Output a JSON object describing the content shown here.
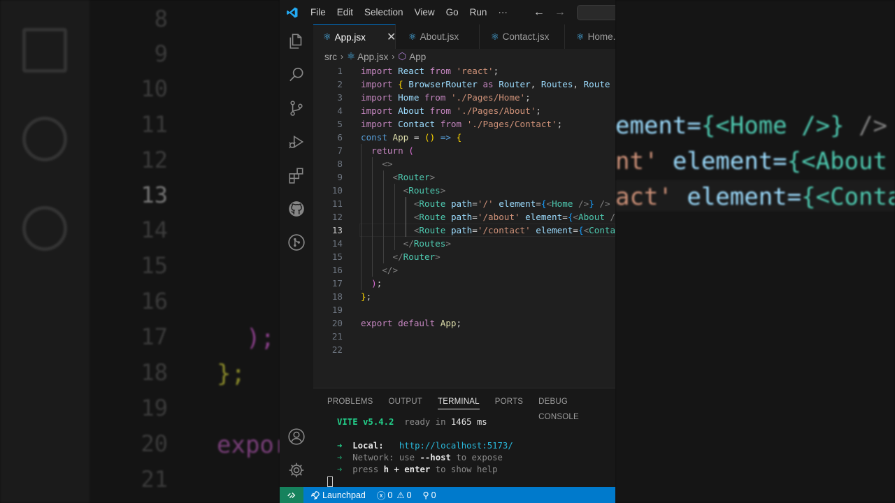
{
  "menu": [
    "File",
    "Edit",
    "Selection",
    "View",
    "Go",
    "Run",
    "···"
  ],
  "nav": {
    "back": "←",
    "forward": "→"
  },
  "tabs": [
    {
      "label": "App.jsx",
      "active": true,
      "close": "✕"
    },
    {
      "label": "About.jsx",
      "active": false
    },
    {
      "label": "Contact.jsx",
      "active": false
    },
    {
      "label": "Home.",
      "active": false
    }
  ],
  "breadcrumb": {
    "folder": "src",
    "file": "App.jsx",
    "symbol": "App"
  },
  "editor": {
    "current_line": 13,
    "line_numbers": [
      "1",
      "2",
      "3",
      "4",
      "5",
      "6",
      "7",
      "8",
      "9",
      "10",
      "11",
      "12",
      "13",
      "14",
      "15",
      "16",
      "17",
      "18",
      "19",
      "20",
      "21",
      "22"
    ]
  },
  "panel": {
    "tabs": [
      "PROBLEMS",
      "OUTPUT",
      "TERMINAL",
      "PORTS",
      "DEBUG CONSOLE"
    ],
    "active_tab": "TERMINAL",
    "terminal": {
      "vite": "VITE v5.4.2",
      "ready": "ready in",
      "ms": "1465 ms",
      "arrow": "➜",
      "local_label": "Local:",
      "local_url": "http://localhost:5173/",
      "network_label": "Network:",
      "network_use": "use",
      "network_flag": "--host",
      "network_rest": "to expose",
      "press": "press",
      "keys": "h + enter",
      "help": "to show help"
    }
  },
  "status": {
    "launchpad": "Launchpad",
    "errors": "0",
    "warnings": "0",
    "ports": "0"
  },
  "background": {
    "left_numbers": [
      "8",
      "9",
      "10",
      "11",
      "12",
      "13",
      "14",
      "15",
      "16",
      "17",
      "18",
      "19",
      "20",
      "21"
    ],
    "left_code": {
      "l17": ");",
      "l18": "};",
      "l20": "expor"
    },
    "right_code": {
      "l11a": "ement=",
      "l11b": "{<Home />}",
      "l11c": " />",
      "l12a": "nt'",
      "l12b": " element=",
      "l12c": "{<About /",
      "l13a": "act'",
      "l13b": " element=",
      "l13c": "{<Conta"
    }
  },
  "colors": {
    "statusbar": "#007acc",
    "remote": "#16825d",
    "accent": "#0078d4",
    "keyword": "#c586c0",
    "string": "#ce9178",
    "variable": "#9cdcfe",
    "tag": "#4ec9b0"
  }
}
